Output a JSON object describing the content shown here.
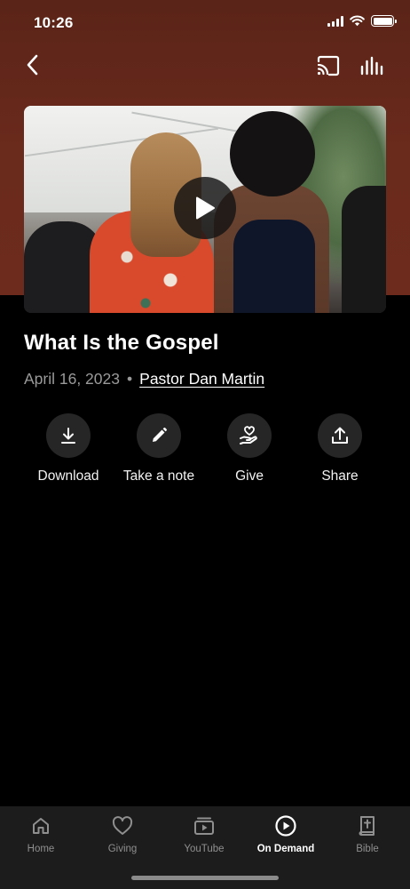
{
  "status_bar": {
    "time": "10:26"
  },
  "header": {
    "back_icon": "chevron-left-icon",
    "cast_icon": "cast-icon",
    "audio_icon": "audio-bars-icon"
  },
  "video": {
    "play_icon": "play-icon"
  },
  "sermon": {
    "title": "What Is the Gospel",
    "date": "April 16, 2023",
    "separator": "•",
    "speaker": "Pastor Dan Martin"
  },
  "actions": [
    {
      "label": "Download",
      "icon": "download-icon"
    },
    {
      "label": "Take a note",
      "icon": "pencil-icon"
    },
    {
      "label": "Give",
      "icon": "giving-hand-icon"
    },
    {
      "label": "Share",
      "icon": "share-icon"
    }
  ],
  "tab_bar": {
    "tabs": [
      {
        "label": "Home",
        "icon": "home-icon",
        "active": false
      },
      {
        "label": "Giving",
        "icon": "heart-icon",
        "active": false
      },
      {
        "label": "YouTube",
        "icon": "youtube-icon",
        "active": false
      },
      {
        "label": "On Demand",
        "icon": "play-circle-icon",
        "active": true
      },
      {
        "label": "Bible",
        "icon": "bible-icon",
        "active": false
      }
    ]
  },
  "colors": {
    "hero_background": "#6a2a1c",
    "page_background": "#000000",
    "tab_bar_background": "#1c1c1c",
    "inactive_tab": "#8f8f8f",
    "active_tab": "#ffffff"
  }
}
